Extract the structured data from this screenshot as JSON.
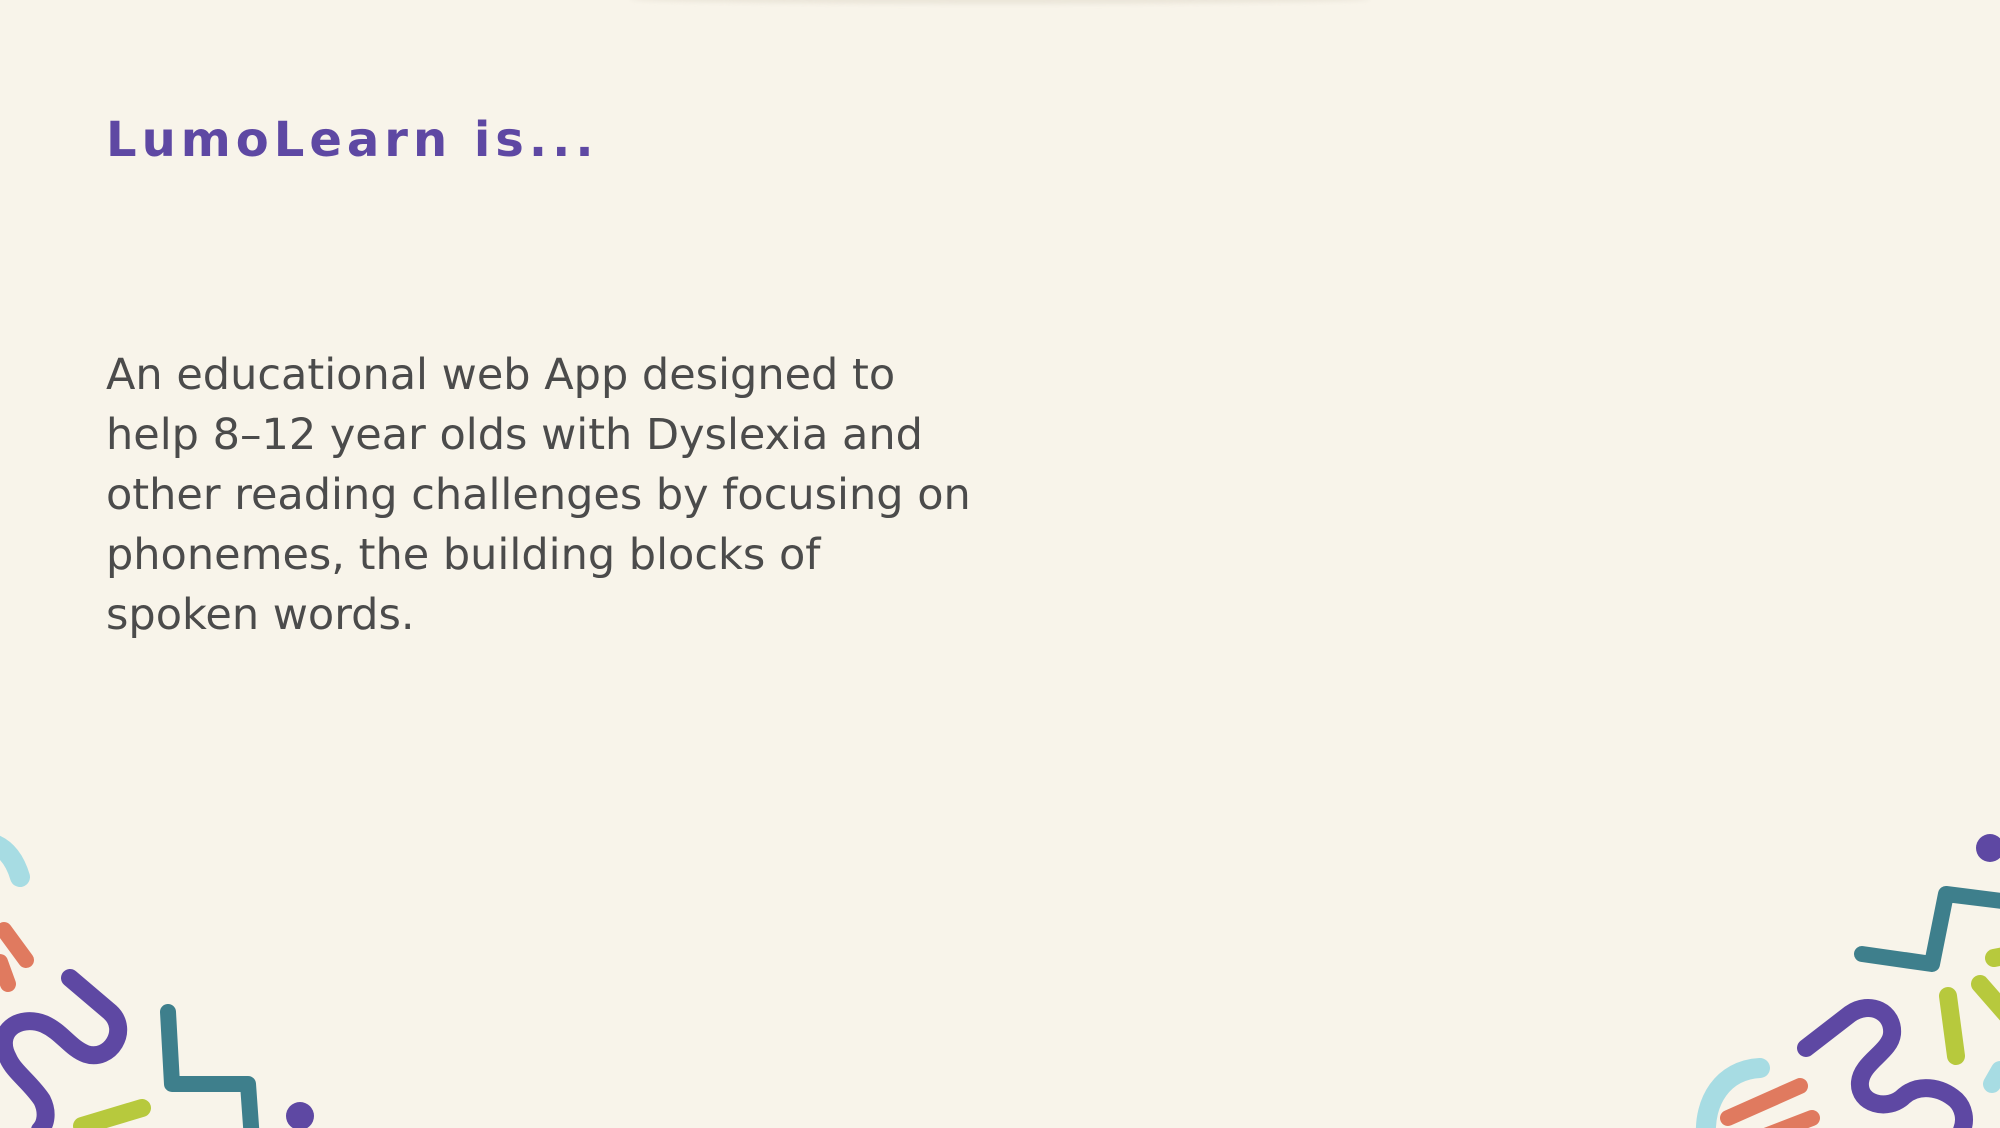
{
  "slide": {
    "heading": "LumoLearn is...",
    "description_lines": [
      "An educational web App designed to",
      "help 8–12 year olds with Dyslexia and",
      "other reading challenges by focusing on",
      "phonemes, the building blocks of",
      "spoken words."
    ]
  },
  "theme": {
    "background": "#f8f4ea",
    "heading_color": "#5e48a3",
    "text_color": "#4b4b4b",
    "accent_purple": "#5e48a3",
    "accent_teal": "#3e7f8c",
    "accent_light_blue": "#a7dce3",
    "accent_coral": "#e07a5f",
    "accent_lime": "#b7c93d"
  },
  "icons": {
    "left_decoration": "colorful-squiggle-shapes",
    "right_decoration": "colorful-squiggle-shapes"
  }
}
